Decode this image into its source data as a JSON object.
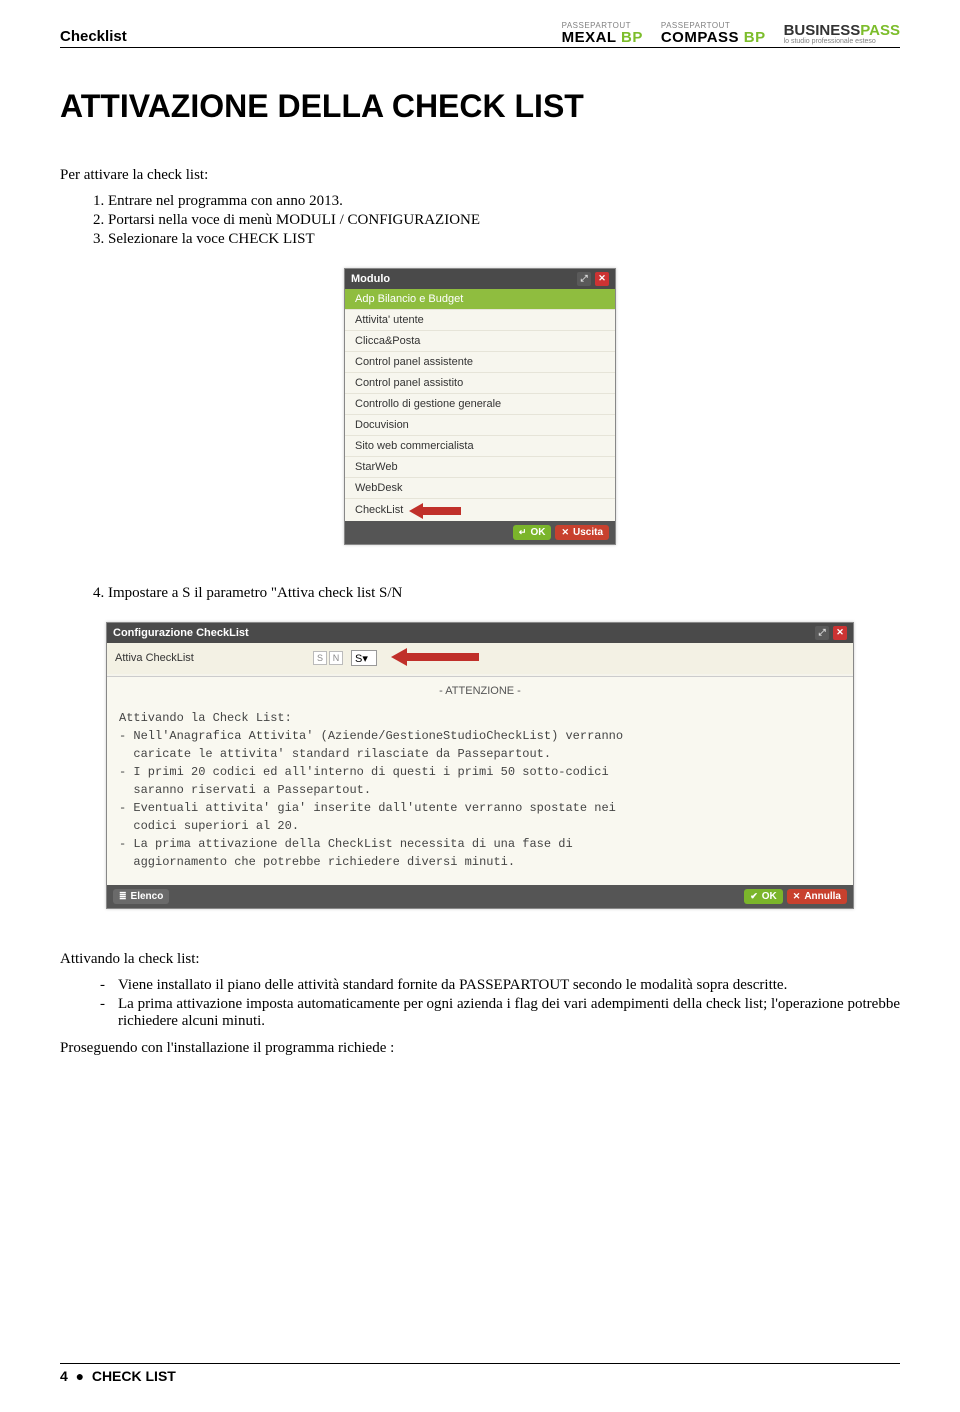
{
  "header": {
    "checklist": "Checklist",
    "logos": {
      "passepartout": "PASSEPARTOUT",
      "mexal": "MEXAL",
      "compass": "COMPASS",
      "bp": "BP",
      "businesspass": "BUSINESSPASS",
      "tagline": "lo studio professionale esteso"
    }
  },
  "title": "ATTIVAZIONE DELLA CHECK LIST",
  "intro": "Per attivare la check list:",
  "steps": [
    "Entrare nel programma con anno 2013.",
    "Portarsi nella voce di menù MODULI / CONFIGURAZIONE",
    "Selezionare la voce CHECK LIST"
  ],
  "step4": "Impostare a S il parametro \"Attiva check list S/N",
  "modulo_window": {
    "title": "Modulo",
    "items": [
      "Adp Bilancio e Budget",
      "Attivita' utente",
      "Clicca&Posta",
      "Control panel assistente",
      "Control panel assistito",
      "Controllo di gestione generale",
      "Docuvision",
      "Sito web commercialista",
      "StarWeb",
      "WebDesk",
      "CheckList"
    ],
    "ok": "OK",
    "uscita": "Uscita"
  },
  "config_window": {
    "title": "Configurazione CheckList",
    "label": "Attiva CheckList",
    "sn_s": "S",
    "sn_n": "N",
    "value": "S▾",
    "attenzione": "- ATTENZIONE -",
    "body": "Attivando la Check List:\n- Nell'Anagrafica Attivita' (Aziende/GestioneStudioCheckList) verranno\n  caricate le attivita' standard rilasciate da Passepartout.\n- I primi 20 codici ed all'interno di questi i primi 50 sotto-codici\n  saranno riservati a Passepartout.\n- Eventuali attivita' gia' inserite dall'utente verranno spostate nei\n  codici superiori al 20.\n- La prima attivazione della CheckList necessita di una fase di\n  aggiornamento che potrebbe richiedere diversi minuti.",
    "elenco": "Elenco",
    "ok": "OK",
    "annulla": "Annulla"
  },
  "attivando_intro": "Attivando la check list:",
  "attivando_items": [
    "Viene installato il piano delle attività standard fornite da PASSEPARTOUT secondo le modalità sopra descritte.",
    "La prima attivazione imposta automaticamente per ogni azienda i flag dei vari adempimenti della check list; l'operazione potrebbe richiedere alcuni minuti."
  ],
  "proseguendo": "Proseguendo con l'installazione il programma richiede :",
  "footer": {
    "page": "4",
    "bullet": "●",
    "label": "CHECK LIST"
  }
}
